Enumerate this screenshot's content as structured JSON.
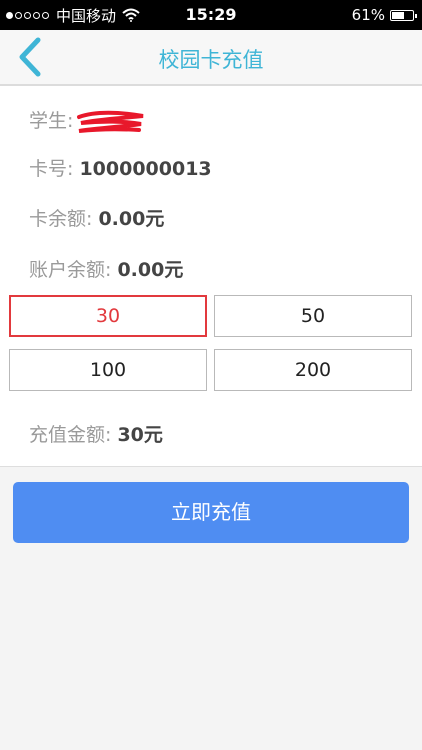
{
  "status_bar": {
    "carrier": "中国移动",
    "time": "15:29",
    "battery_percent": "61%",
    "battery_level": 0.61,
    "signal_strength": 1
  },
  "nav": {
    "title": "校园卡充值",
    "back_icon": "chevron-left-icon"
  },
  "info": {
    "student_label": "学生:",
    "card_label": "卡号: ",
    "card_number": "1000000013",
    "card_balance_label": "卡余额: ",
    "card_balance_value": "0.00",
    "account_balance_label": "账户余额: ",
    "account_balance_value": "0.00",
    "currency_unit": "元"
  },
  "amount_options": [
    {
      "label": "30",
      "selected": true
    },
    {
      "label": "50",
      "selected": false
    },
    {
      "label": "100",
      "selected": false
    },
    {
      "label": "200",
      "selected": false
    }
  ],
  "recharge": {
    "amount_label": "充值金额: ",
    "amount_value": "30",
    "button_label": "立即充值"
  },
  "colors": {
    "accent": "#3fb5d6",
    "selected": "#e2393d",
    "primary_button": "#4f8df2"
  }
}
